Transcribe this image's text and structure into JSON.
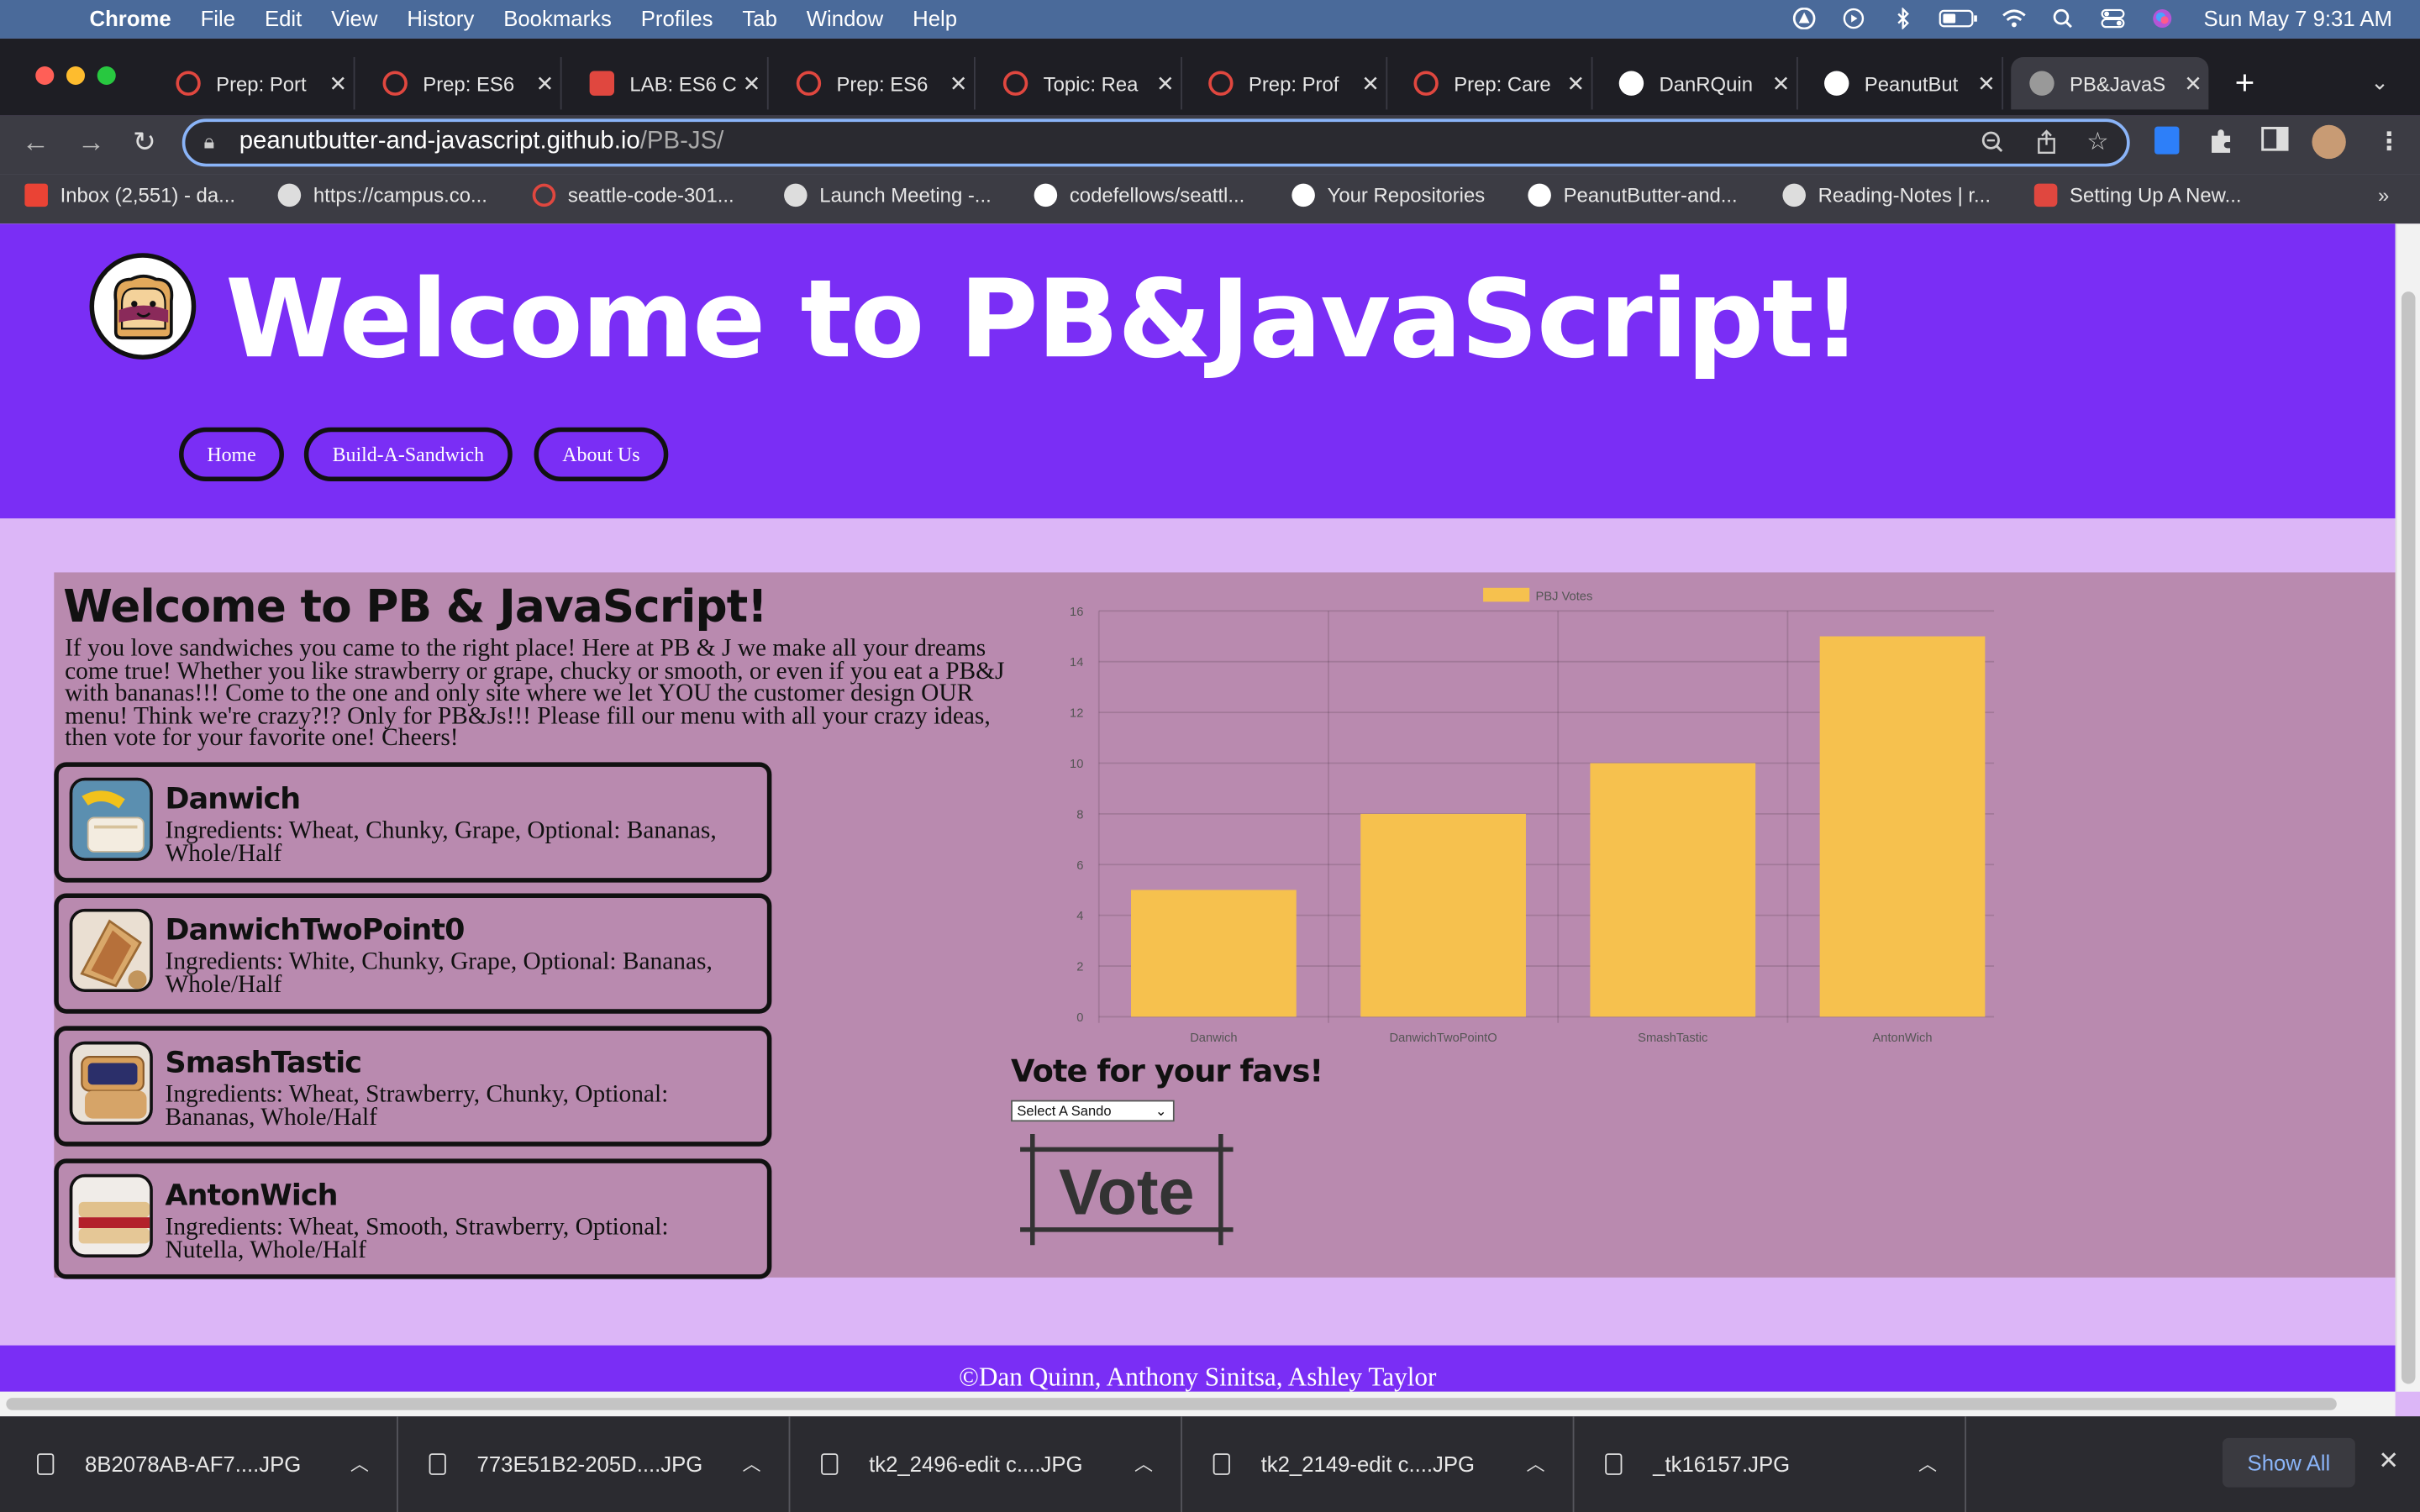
{
  "menubar": {
    "app": "Chrome",
    "items": [
      "File",
      "Edit",
      "View",
      "History",
      "Bookmarks",
      "Profiles",
      "Tab",
      "Window",
      "Help"
    ],
    "clock": "Sun May 7  9:31 AM"
  },
  "tabs": [
    {
      "title": "Prep: Port",
      "icon": "codefellows-icon",
      "color": "#e0473f"
    },
    {
      "title": "Prep: ES6",
      "icon": "codefellows-icon",
      "color": "#e0473f"
    },
    {
      "title": "LAB: ES6 C",
      "icon": "shield-icon",
      "color": "#e0473f"
    },
    {
      "title": "Prep: ES6",
      "icon": "codefellows-icon",
      "color": "#e0473f"
    },
    {
      "title": "Topic: Rea",
      "icon": "codefellows-icon",
      "color": "#e0473f"
    },
    {
      "title": "Prep: Prof",
      "icon": "codefellows-icon",
      "color": "#e0473f"
    },
    {
      "title": "Prep: Care",
      "icon": "codefellows-icon",
      "color": "#e0473f"
    },
    {
      "title": "DanRQuin",
      "icon": "github-icon",
      "color": "#ffffff"
    },
    {
      "title": "PeanutBut",
      "icon": "github-icon",
      "color": "#ffffff"
    },
    {
      "title": "PB&JavaS",
      "icon": "globe-icon",
      "color": "#bbbbbb",
      "active": true
    }
  ],
  "address": {
    "host": "peanutbutter-and-javascript.github.io",
    "path": "/PB-JS/"
  },
  "bookmarks": [
    {
      "label": "Inbox (2,551) - da...",
      "icon": "gmail-icon"
    },
    {
      "label": "https://campus.co...",
      "icon": "globe-icon"
    },
    {
      "label": "seattle-code-301...",
      "icon": "codefellows-icon"
    },
    {
      "label": "Launch Meeting -...",
      "icon": "globe-icon"
    },
    {
      "label": "codefellows/seattl...",
      "icon": "github-icon"
    },
    {
      "label": "Your Repositories",
      "icon": "github-icon"
    },
    {
      "label": "PeanutButter-and...",
      "icon": "github-icon"
    },
    {
      "label": "Reading-Notes | r...",
      "icon": "globe-icon"
    },
    {
      "label": "Setting Up A New...",
      "icon": "shield-icon"
    }
  ],
  "site": {
    "title": "Welcome to PB&JavaScript!",
    "nav": [
      "Home",
      "Build-A-Sandwich",
      "About Us"
    ],
    "heading": "Welcome to PB & JavaScript!",
    "intro": "If you love sandwiches you came to the right place! Here at PB & J we make all your dreams come true! Whether you like strawberry or grape, chucky or smooth, or even if you eat a PB&J with bananas!!! Come to the one and only site where we let YOU the customer design OUR menu! Think we're crazy?!? Only for PB&Js!!! Please fill our menu with all your crazy ideas, then vote for your favorite one! Cheers!",
    "sandwiches": [
      {
        "name": "Danwich",
        "ingredients": "Ingredients: Wheat, Chunky, Grape, Optional: Bananas, Whole/Half"
      },
      {
        "name": "DanwichTwoPoint0",
        "ingredients": "Ingredients: White, Chunky, Grape, Optional: Bananas, Whole/Half"
      },
      {
        "name": "SmashTastic",
        "ingredients": "Ingredients: Wheat, Strawberry, Chunky, Optional: Bananas, Whole/Half"
      },
      {
        "name": "AntonWich",
        "ingredients": "Ingredients: Wheat, Smooth, Strawberry, Optional: Nutella, Whole/Half"
      }
    ],
    "vote_heading": "Vote for your favs!",
    "select_value": "Select A Sando",
    "vote_button": "Vote",
    "footer": "©Dan Quinn, Anthony Sinitsa, Ashley Taylor"
  },
  "chart_data": {
    "type": "bar",
    "categories": [
      "Danwich",
      "DanwichTwoPointO",
      "SmashTastic",
      "AntonWich"
    ],
    "series": [
      {
        "name": "PBJ Votes",
        "values": [
          5,
          8,
          10,
          15
        ]
      }
    ],
    "ylim": [
      0,
      16
    ],
    "yticks": [
      0,
      2,
      4,
      6,
      8,
      10,
      12,
      14,
      16
    ],
    "bar_color": "#f6c14e",
    "legend": "top",
    "grid": true
  },
  "downloads": [
    "8B2078AB-AF7....JPG",
    "773E51B2-205D....JPG",
    "tk2_2496-edit c....JPG",
    "tk2_2149-edit c....JPG",
    "_tk16157.JPG"
  ],
  "show_all": "Show All",
  "colors": {
    "header": "#7a2ef5",
    "background": "#dcb6f7",
    "main_box": "#b98aaf"
  }
}
